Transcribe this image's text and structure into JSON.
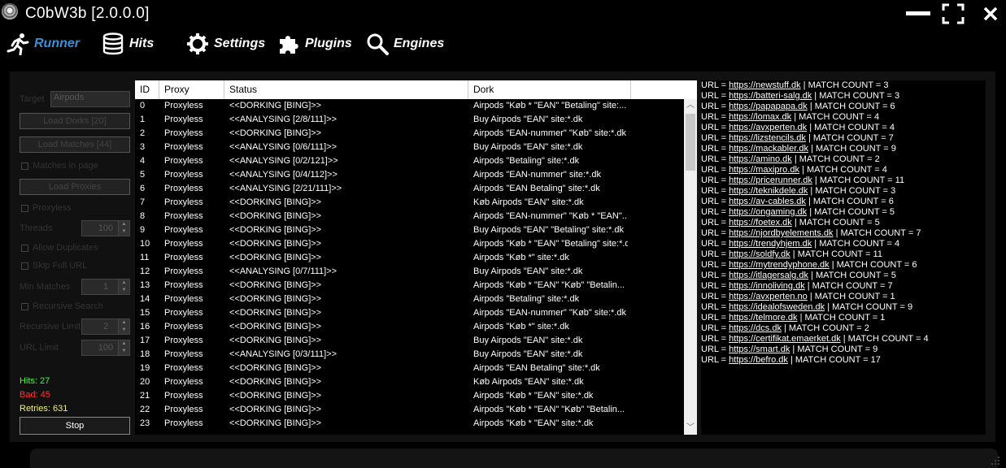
{
  "window": {
    "title": "C0bW3b [2.0.0.0]"
  },
  "nav": {
    "runner": "Runner",
    "hits": "Hits",
    "settings": "Settings",
    "plugins": "Plugins",
    "engines": "Engines"
  },
  "left_panel": {
    "target_label": "Target",
    "target_value": "Airpods",
    "load_dorks": "Load Dorks [20]",
    "load_matches": "Load Matches [44]",
    "matches_in_page": "Matches in page",
    "load_proxies": "Load Proxies",
    "proxyless": "Proxyless",
    "threads_label": "Threads",
    "threads_value": "100",
    "allow_duplicates": "Allow Duplicates",
    "skip_full_url": "Skip Full URL",
    "min_matches_label": "Min Matches",
    "min_matches_value": "1",
    "recursive_search": "Recursive Search",
    "recursive_limit_label": "Recursive Limit",
    "recursive_limit_value": "2",
    "url_limit_label": "URL Limit",
    "url_limit_value": "100",
    "hits": "Hits: 27",
    "bad": "Bad: 45",
    "retries": "Retries: 631",
    "stop": "Stop"
  },
  "colors": {
    "accent": "#3a8fd6",
    "hits": "#3cff3c",
    "bad": "#ff3030",
    "retries": "#f2f27a"
  },
  "grid": {
    "columns": [
      "ID",
      "Proxy",
      "Status",
      "Dork"
    ],
    "rows": [
      [
        "0",
        "Proxyless",
        "<<DORKING [BING]>>",
        "Airpods \"Køb * \"EAN\" \"Betaling\" site:..."
      ],
      [
        "1",
        "Proxyless",
        "<<ANALYSING [2/8/111]>>",
        "Buy Airpods \"EAN\" site:*.dk"
      ],
      [
        "2",
        "Proxyless",
        "<<DORKING [BING]>>",
        "Airpods \"EAN-nummer\" \"Køb\" site:*.dk"
      ],
      [
        "3",
        "Proxyless",
        "<<ANALYSING [0/6/111]>>",
        "Buy Airpods \"EAN\" site:*.dk"
      ],
      [
        "4",
        "Proxyless",
        "<<ANALYSING [0/2/121]>>",
        "Airpods \"Betaling\" site:*.dk"
      ],
      [
        "5",
        "Proxyless",
        "<<ANALYSING [0/4/112]>>",
        "Airpods \"EAN-nummer\" site:*.dk"
      ],
      [
        "6",
        "Proxyless",
        "<<ANALYSING [2/21/111]>>",
        "Airpods \"EAN Betaling\" site:*.dk"
      ],
      [
        "7",
        "Proxyless",
        "<<DORKING [BING]>>",
        "Køb Airpods \"EAN\" site:*.dk"
      ],
      [
        "8",
        "Proxyless",
        "<<DORKING [BING]>>",
        "Airpods \"EAN-nummer\" \"Køb * \"EAN\"..."
      ],
      [
        "9",
        "Proxyless",
        "<<DORKING [BING]>>",
        "Buy Airpods \"EAN\" \"Betaling\" site:*.dk"
      ],
      [
        "10",
        "Proxyless",
        "<<DORKING [BING]>>",
        "Airpods \"Køb * \"EAN\" \"Betaling\" site:*.dk"
      ],
      [
        "11",
        "Proxyless",
        "<<DORKING [BING]>>",
        "Airpods \"Køb *\" site:*.dk"
      ],
      [
        "12",
        "Proxyless",
        "<<ANALYSING [0/7/111]>>",
        "Buy Airpods \"EAN\" site:*.dk"
      ],
      [
        "13",
        "Proxyless",
        "<<DORKING [BING]>>",
        "Airpods \"Køb * \"EAN\" \"Køb\" \"Betalin..."
      ],
      [
        "14",
        "Proxyless",
        "<<DORKING [BING]>>",
        "Airpods \"Betaling\" site:*.dk"
      ],
      [
        "15",
        "Proxyless",
        "<<DORKING [BING]>>",
        "Airpods \"EAN-nummer\" \"Køb\" site:*.dk"
      ],
      [
        "16",
        "Proxyless",
        "<<DORKING [BING]>>",
        "Airpods \"Køb *\" site:*.dk"
      ],
      [
        "17",
        "Proxyless",
        "<<DORKING [BING]>>",
        "Buy Airpods \"EAN\" site:*.dk"
      ],
      [
        "18",
        "Proxyless",
        "<<ANALYSING [0/3/111]>>",
        "Buy Airpods \"EAN\" site:*.dk"
      ],
      [
        "19",
        "Proxyless",
        "<<DORKING [BING]>>",
        "Airpods \"EAN Betaling\" site:*.dk"
      ],
      [
        "20",
        "Proxyless",
        "<<DORKING [BING]>>",
        "Køb Airpods \"EAN\" site:*.dk"
      ],
      [
        "21",
        "Proxyless",
        "<<DORKING [BING]>>",
        "Airpods \"Køb * \"EAN\" site:*.dk"
      ],
      [
        "22",
        "Proxyless",
        "<<DORKING [BING]>>",
        "Airpods \"Køb * \"EAN\" \"Køb\" \"Betalin..."
      ],
      [
        "23",
        "Proxyless",
        "<<DORKING [BING]>>",
        "Airpods \"Køb * \"EAN\" site:*.dk"
      ]
    ]
  },
  "results": [
    [
      "https://newstuff.dk",
      "3"
    ],
    [
      "https://batteri-salg.dk",
      "3"
    ],
    [
      "https://papapapa.dk",
      "6"
    ],
    [
      "https://lomax.dk",
      "4"
    ],
    [
      "https://avxperten.dk",
      "4"
    ],
    [
      "https://lizstencils.dk",
      "7"
    ],
    [
      "https://mackabler.dk",
      "9"
    ],
    [
      "https://amino.dk",
      "2"
    ],
    [
      "https://maxipro.dk",
      "4"
    ],
    [
      "https://pricerunner.dk",
      "11"
    ],
    [
      "https://teknikdele.dk",
      "3"
    ],
    [
      "https://av-cables.dk",
      "6"
    ],
    [
      "https://ongaming.dk",
      "5"
    ],
    [
      "https://foetex.dk",
      "5"
    ],
    [
      "https://njordbyelements.dk",
      "7"
    ],
    [
      "https://trendyhjem.dk",
      "4"
    ],
    [
      "https://soldfy.dk",
      "11"
    ],
    [
      "https://mytrendyphone.dk",
      "6"
    ],
    [
      "https://itlagersalg.dk",
      "5"
    ],
    [
      "https://innoliving.dk",
      "7"
    ],
    [
      "https://avxperten.no",
      "1"
    ],
    [
      "https://idealofsweden.dk",
      "9"
    ],
    [
      "https://telmore.dk",
      "1"
    ],
    [
      "https://dcs.dk",
      "2"
    ],
    [
      "https://certifikat.emaerket.dk",
      "4"
    ],
    [
      "https://smart.dk",
      "9"
    ],
    [
      "https://befro.dk",
      "17"
    ]
  ],
  "results_labels": {
    "prefix": "URL = ",
    "sep": " | MATCH COUNT = "
  }
}
